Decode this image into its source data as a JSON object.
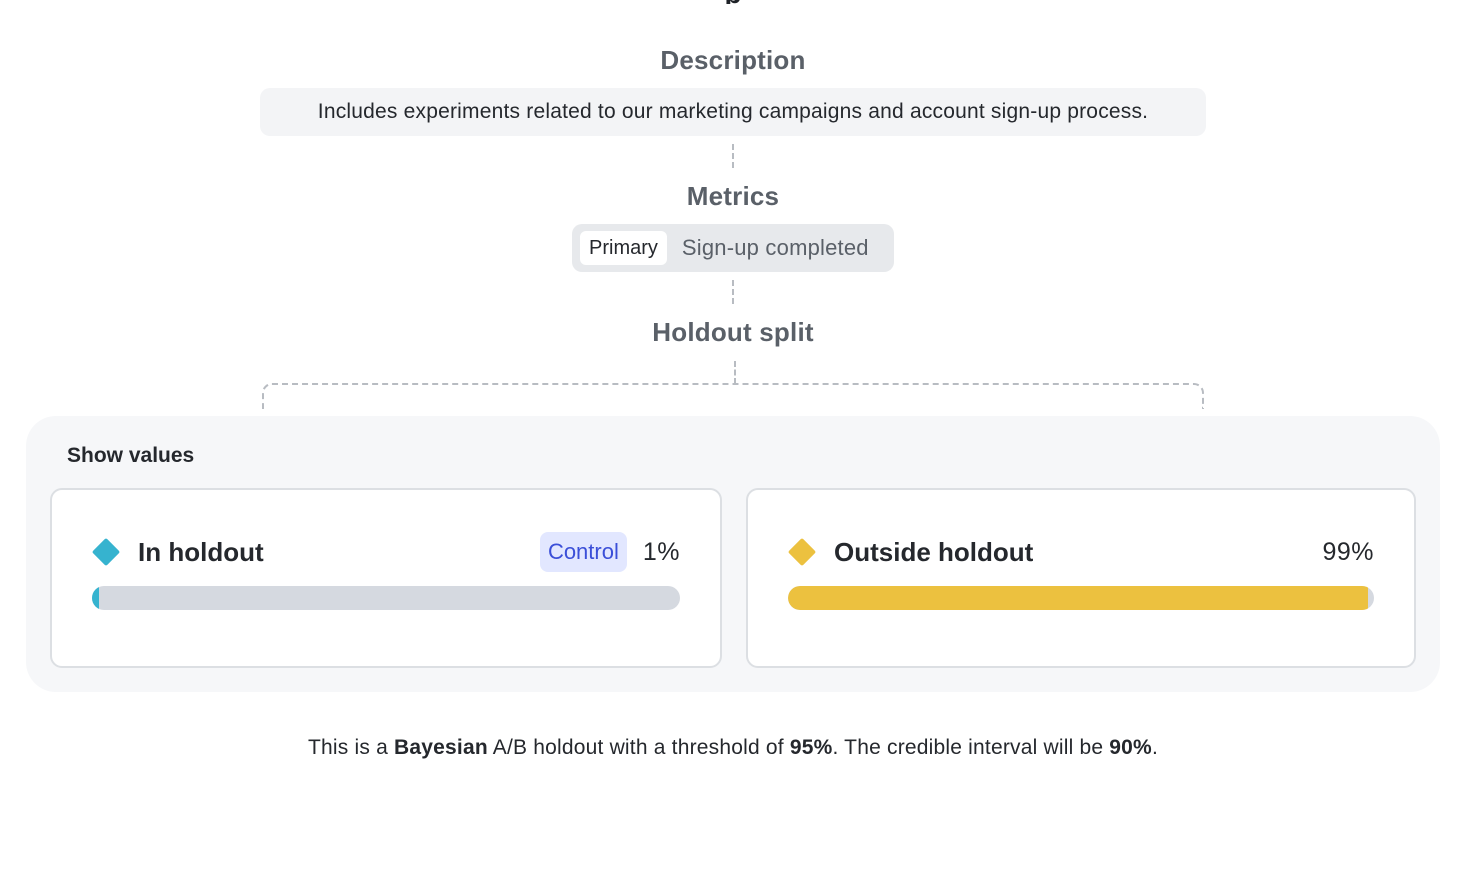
{
  "header": {
    "title_clipped": "p"
  },
  "description": {
    "title": "Description",
    "text": "Includes experiments related to our marketing campaigns and account sign-up process."
  },
  "metrics": {
    "title": "Metrics",
    "tag": "Primary",
    "name": "Sign-up completed"
  },
  "holdout": {
    "title": "Holdout split",
    "show_values_label": "Show values",
    "groups": [
      {
        "label": "In holdout",
        "badge": "Control",
        "percent_label": "1%",
        "fraction": 0.01,
        "color": "#36b3cf"
      },
      {
        "label": "Outside holdout",
        "percent_label": "99%",
        "fraction": 0.99,
        "color": "#ecc13f"
      }
    ]
  },
  "summary": {
    "prefix": "This is a ",
    "method": "Bayesian",
    "middle": " A/B holdout with a threshold of ",
    "threshold": "95%",
    "middle2": ". The credible interval will be ",
    "interval": "90%",
    "suffix": "."
  },
  "colors": {
    "track": "#d5d9e0",
    "badge_bg": "#e2e7ff",
    "badge_text": "#3b4fd8"
  }
}
